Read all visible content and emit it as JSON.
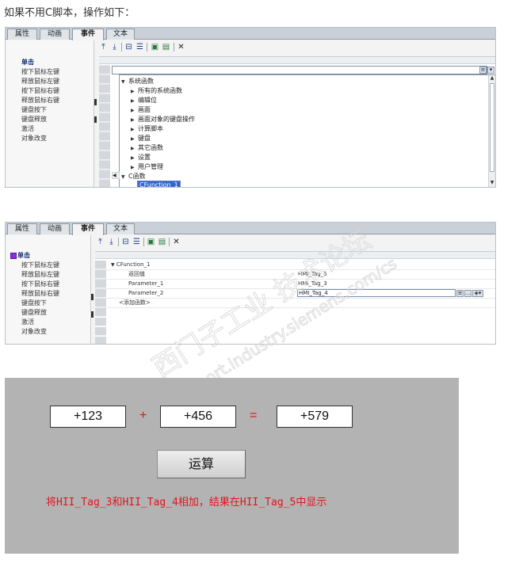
{
  "intro": "如果不用C脚本，操作如下：",
  "tabs": [
    "属性",
    "动画",
    "事件",
    "文本"
  ],
  "events": [
    "单击",
    "按下鼠标左键",
    "释放鼠标左键",
    "按下鼠标右键",
    "释放鼠标右键",
    "键盘按下",
    "键盘释放",
    "激活",
    "对象改变"
  ],
  "panel2_events": [
    "单击",
    "按下鼠标左键",
    "释放鼠标左键",
    "按下鼠标右键",
    "释放鼠标右键",
    "键盘按下",
    "键盘释放",
    "激活",
    "对象改变"
  ],
  "toolbar_icons": [
    "move-up-icon",
    "move-down-icon",
    "expand-icon",
    "collapse-icon",
    "script-icon",
    "library-icon",
    "delete-icon"
  ],
  "dropdown": {
    "system_functions": "系统函数",
    "items": [
      "所有的系统函数",
      "编辑位",
      "画面",
      "画面对象的键盘操作",
      "计算脚本",
      "键盘",
      "其它函数",
      "设置",
      "用户管理"
    ],
    "c_functions": "C函数",
    "selected": "CFunction_1"
  },
  "function_list": {
    "function_name": "CFunction_1",
    "params": [
      {
        "name": "返回值",
        "value": "HMI_Tag_5"
      },
      {
        "name": "Parameter_1",
        "value": "HMI_Tag_3"
      },
      {
        "name": "Parameter_2",
        "value": "HMI_Tag_4"
      }
    ],
    "add_function": "<添加函数>"
  },
  "watermark": {
    "line1": "西门子工业 技术论坛",
    "line2": "support.industry.siemens.com/cs"
  },
  "demo": {
    "input1": "+123",
    "plus": "+",
    "input2": "+456",
    "equals": "=",
    "result": "+579",
    "button": "运算",
    "note": "将HII_Tag_3和HII_Tag_4相加，结果在HII_Tag_5中显示"
  },
  "colors": {
    "panel_bg": "#f3f3f3",
    "demo_bg": "#b3b3b3",
    "note_color": "#e0161f",
    "selection": "#3366cc"
  }
}
